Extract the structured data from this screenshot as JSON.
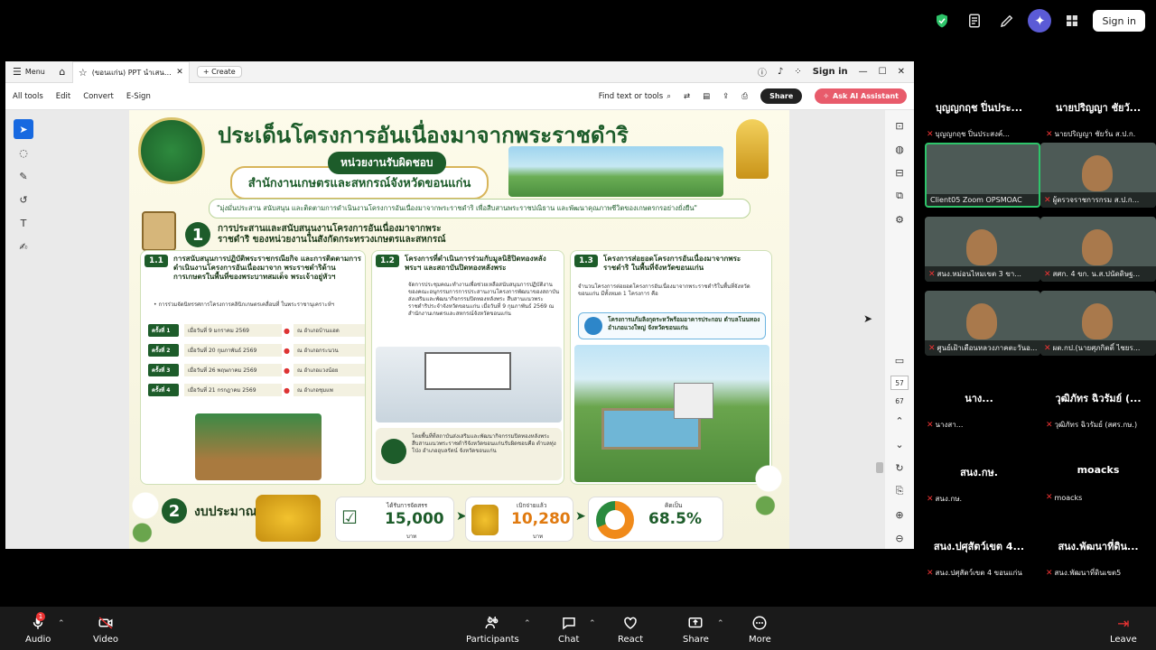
{
  "zoom_top": {
    "signin": "Sign in"
  },
  "acrobat": {
    "menu": "Menu",
    "tab_name": "(ขอนแก่น) PPT นำเสนอตร...",
    "create": "Create",
    "signin": "Sign in",
    "toolbar": {
      "all_tools": "All tools",
      "edit": "Edit",
      "convert": "Convert",
      "esign": "E-Sign",
      "find": "Find text or tools",
      "share": "Share",
      "ai": "Ask AI Assistant"
    },
    "page_current": "57",
    "page_total": "67"
  },
  "slide": {
    "title": "ประเด็นโครงการอันเนื่องมาจากพระราชดำริ",
    "responsible": "หน่วยงานรับผิดชอบ",
    "office": "สำนักงานเกษตรและสหกรณ์จังหวัดขอนแก่น",
    "mission": "\"มุ่งมั่นประสาน สนับสนุน และติดตามการดำเนินงานโครงการอันเนื่องมาจากพระราชดำริ เพื่อสืบสานพระราชปณิธาน และพัฒนาคุณภาพชีวิตของเกษตรกรอย่างยั่งยืน\"",
    "section1_num": "1",
    "section1_title": "การประสานและสนับสนุนงานโครงการอันเนื่องมาจากพระราชดำริ ของหน่วยงานในสังกัดกระทรวงเกษตรและสหกรณ์",
    "p1": {
      "tag": "1.1",
      "title": "การสนับสนุนการปฏิบัติพระราชกรณียกิจ และการติดตามการดำเนินงานโครงการอันเนื่องมาจาก พระราชดำริด้านการเกษตรในพื้นที่ของพระบาทสมเด็จ พระเจ้าอยู่หัวฯ",
      "bullet": "• การร่วมจัดนิทรรศการโครงการคลินิกเกษตรเคลื่อนที่ ในพระราชานุเคราะห์ฯ",
      "rounds": [
        {
          "label": "ครั้งที่ 1",
          "date": "เมื่อวันที่ 9 มกราคม 2569",
          "loc": "ณ อำเภอบ้านแฮด"
        },
        {
          "label": "ครั้งที่ 2",
          "date": "เมื่อวันที่ 20 กุมภาพันธ์ 2569",
          "loc": "ณ อำเภอกระนวน"
        },
        {
          "label": "ครั้งที่ 3",
          "date": "เมื่อวันที่ 26 พฤษภาคม 2569",
          "loc": "ณ อำเภอแวงน้อย"
        },
        {
          "label": "ครั้งที่ 4",
          "date": "เมื่อวันที่ 21 กรกฎาคม 2569",
          "loc": "ณ อำเภอชุมแพ"
        }
      ]
    },
    "p2": {
      "tag": "1.2",
      "title": "โครงการที่ดำเนินการร่วมกับมูลนิธิปิดทองหลังพระฯ และสถาบันปิดทองหลังพระ",
      "text": "จัดการประชุมคณะทำงานเพื่อช่วยเหลือสนับสนุนการปฏิบัติงานของคณะอนุกรรมการการประสานงานโครงการพัฒนาของสถาบันส่งเสริมและพัฒนากิจกรรมปิดทองหลังพระ สืบสานแนวพระราชดำริประจำจังหวัดขอนแก่น เมื่อวันที่ 9 กุมภาพันธ์ 2569 ณ สำนักงานเกษตรและสหกรณ์จังหวัดขอนแก่น",
      "foot": "โดยพื้นที่ที่สถาบันส่งเสริมและพัฒนากิจกรรมปิดทองหลังพระ สืบสานแนวพระราชดำริจังหวัดขอนแก่นรับผิดชอบคือ ตำบลทุ่งโป่ง อำเภออุบลรัตน์ จังหวัดขอนแก่น"
    },
    "p3": {
      "tag": "1.3",
      "title": "โครงการส่อยอดโครงการอันเนื่องมาจากพระราชดำริ ในพื้นที่จังหวัดขอนแก่น",
      "text": "จำนวนโครงการต่อยอดโครงการอันเนื่องมาจากพระราชดำริในพื้นที่จังหวัดขอนแก่น มีทั้งหมด 1 โครงการ คือ",
      "box": "โครงการแก้มลิงกุดระหว้พร้อมอาคารประกอบ ตำบลโนนทอง อำเภอแวงใหญ่ จังหวัดขอนแก่น"
    },
    "section2_num": "2",
    "budget_title": "งบประมาณ",
    "budget": [
      {
        "label": "ได้รับการจัดสรร",
        "value": "15,000",
        "unit": "บาท",
        "color": "#1d5c2a"
      },
      {
        "label": "เบิกจ่ายแล้ว",
        "value": "10,280",
        "unit": "บาท",
        "color": "#e07a10"
      },
      {
        "label": "คิดเป็น",
        "value": "68.5%",
        "unit": "",
        "color": "#1d5c2a"
      }
    ],
    "page_number": "57"
  },
  "participants": [
    {
      "name": "บุญญกฤช ปิ่นประ...",
      "footer": "บุญญกฤช ปิ่นประสงค์...",
      "video": false
    },
    {
      "name": "นายปริญญา ชัยวั...",
      "footer": "นายปริญญา ชัยวั่น ส.ป.ก.",
      "video": false
    },
    {
      "name": "",
      "footer": "Client05 Zoom OPSMOAC",
      "video": true,
      "active": true
    },
    {
      "name": "",
      "footer": "ผู้ตรวจราชการกรม ส.ป.ก...",
      "video": true
    },
    {
      "name": "",
      "footer": "สนง.หม่อนไหมเขต 3 ขา...",
      "video": true
    },
    {
      "name": "",
      "footer": "สศก. 4 ขก. น.ส.ปนัดดิษฐ...",
      "video": true
    },
    {
      "name": "",
      "footer": "ศูนย์เฝ้าเตือนหลวงภาคตะวันอ...",
      "video": true
    },
    {
      "name": "",
      "footer": "ผต.กป.(นายศุภกิตติ์ ไชยร...",
      "video": true
    },
    {
      "name": "นาง...",
      "footer": "นางสา...",
      "video": false
    },
    {
      "name": "วุฒิภัทร ฉิวรัมย์ (...",
      "footer": "วุฒิภัทร ฉิวรัมย์ (สศร.กษ.)",
      "video": false
    },
    {
      "name": "สนง.กษ.",
      "footer": "สนง.กษ.",
      "video": false
    },
    {
      "name": "moacks",
      "footer": "moacks",
      "video": false
    },
    {
      "name": "สนง.ปศุสัตว์เขต 4...",
      "footer": "สนง.ปศุสัตว์เขต 4 ขอนแก่น",
      "video": false
    },
    {
      "name": "สนง.พัฒนาที่ดิน...",
      "footer": "สนง.พัฒนาที่ดินเขต5",
      "video": false
    }
  ],
  "bottom_bar": {
    "audio": "Audio",
    "video": "Video",
    "participants": "Participants",
    "participants_count": "14",
    "chat": "Chat",
    "react": "React",
    "share": "Share",
    "more": "More",
    "leave": "Leave",
    "audio_badge": "1"
  }
}
